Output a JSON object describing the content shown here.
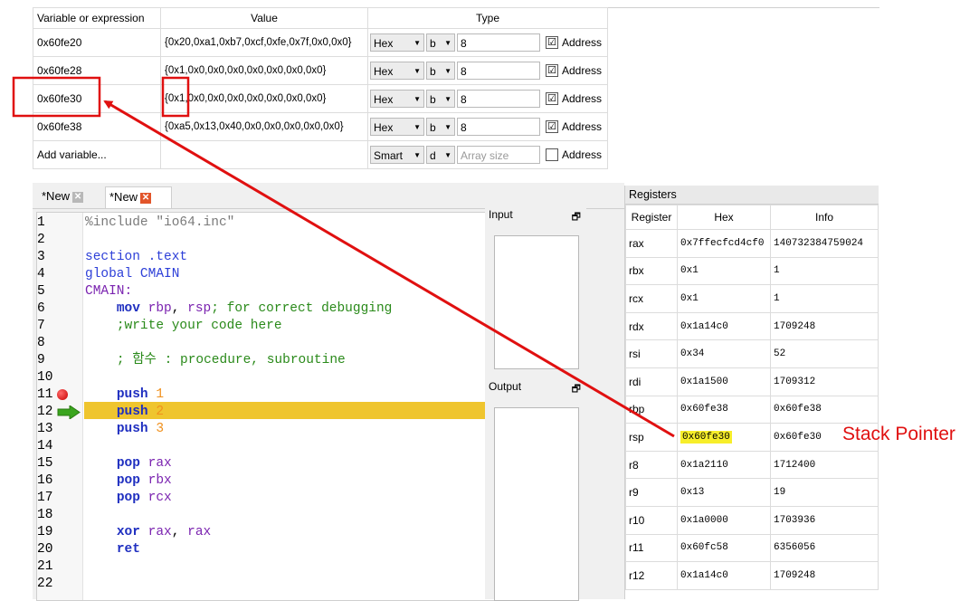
{
  "watch": {
    "headers": [
      "Variable or expression",
      "Value",
      "Type"
    ],
    "rows": [
      {
        "var": "0x60fe20",
        "value": "{0x20,0xa1,0xb7,0xcf,0xfe,0x7f,0x0,0x0}",
        "format": "Hex",
        "size": "b",
        "count": "8",
        "address_label": "Address",
        "address_checked": "☑"
      },
      {
        "var": "0x60fe28",
        "value": "{0x1,0x0,0x0,0x0,0x0,0x0,0x0,0x0}",
        "format": "Hex",
        "size": "b",
        "count": "8",
        "address_label": "Address",
        "address_checked": "☑"
      },
      {
        "var": "0x60fe30",
        "value": "{0x1,0x0,0x0,0x0,0x0,0x0,0x0,0x0}",
        "format": "Hex",
        "size": "b",
        "count": "8",
        "address_label": "Address",
        "address_checked": "☑"
      },
      {
        "var": "0x60fe38",
        "value": "{0xa5,0x13,0x40,0x0,0x0,0x0,0x0,0x0}",
        "format": "Hex",
        "size": "b",
        "count": "8",
        "address_label": "Address",
        "address_checked": "☑"
      }
    ],
    "add_row": {
      "var": "Add variable...",
      "format": "Smart",
      "size": "d",
      "count_placeholder": "Array size",
      "address_label": "Address"
    }
  },
  "tabs": [
    {
      "label": "*New",
      "close": "✕"
    },
    {
      "label": "*New",
      "close": "✕"
    }
  ],
  "code": {
    "line_numbers": [
      "1",
      "2",
      "3",
      "4",
      "5",
      "6",
      "7",
      "8",
      "9",
      "10",
      "11",
      "12",
      "13",
      "14",
      "15",
      "16",
      "17",
      "18",
      "19",
      "20",
      "21",
      "22"
    ],
    "l1": {
      "a": "%include",
      "b": " \"io64.inc\""
    },
    "l3": "section .text",
    "l4": "global CMAIN",
    "l5": "CMAIN:",
    "l6": {
      "kw": "mov",
      "r1": "rbp",
      "sep": ",",
      "r2": "rsp",
      "comment": "; for correct debugging"
    },
    "l7": ";write your code here",
    "l9": "; 함수 : procedure, subroutine",
    "l11": {
      "kw": "push",
      "n": "1"
    },
    "l12": {
      "kw": "push",
      "n": "2"
    },
    "l13": {
      "kw": "push",
      "n": "3"
    },
    "l15": {
      "kw": "pop",
      "r": "rax"
    },
    "l16": {
      "kw": "pop",
      "r": "rbx"
    },
    "l17": {
      "kw": "pop",
      "r": "rcx"
    },
    "l19": {
      "kw": "xor",
      "r1": "rax",
      "sep": ",",
      "r2": "rax"
    },
    "l20": {
      "kw": "ret"
    }
  },
  "panels": {
    "input": "Input",
    "output": "Output",
    "pin": "🗗"
  },
  "registers": {
    "title": "Registers",
    "headers": [
      "Register",
      "Hex",
      "Info"
    ],
    "rows": [
      {
        "reg": "rax",
        "hex": "0x7ffecfcd4cf0",
        "info": "140732384759024"
      },
      {
        "reg": "rbx",
        "hex": "0x1",
        "info": "1"
      },
      {
        "reg": "rcx",
        "hex": "0x1",
        "info": "1"
      },
      {
        "reg": "rdx",
        "hex": "0x1a14c0",
        "info": "1709248"
      },
      {
        "reg": "rsi",
        "hex": "0x34",
        "info": "52"
      },
      {
        "reg": "rdi",
        "hex": "0x1a1500",
        "info": "1709312"
      },
      {
        "reg": "rbp",
        "hex": "0x60fe38",
        "info": "0x60fe38"
      },
      {
        "reg": "rsp",
        "hex": "0x60fe30",
        "info": "0x60fe30"
      },
      {
        "reg": "r8",
        "hex": "0x1a2110",
        "info": "1712400"
      },
      {
        "reg": "r9",
        "hex": "0x13",
        "info": "19"
      },
      {
        "reg": "r10",
        "hex": "0x1a0000",
        "info": "1703936"
      },
      {
        "reg": "r11",
        "hex": "0x60fc58",
        "info": "6356056"
      },
      {
        "reg": "r12",
        "hex": "0x1a14c0",
        "info": "1709248"
      }
    ]
  },
  "annotation": {
    "label": "Stack Pointer",
    "color": "#e01010"
  },
  "colors": {
    "highlight": "#efc52e",
    "breakpoint": "#c80000",
    "current_line_arrow": "#3aa51e",
    "rsp_highlight": "#f7ee2a"
  }
}
